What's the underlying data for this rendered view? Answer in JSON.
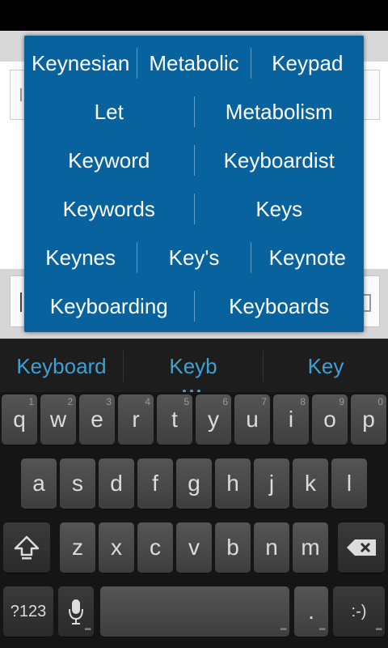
{
  "popup": {
    "rows": [
      [
        "Keynesian",
        "Metabolic",
        "Keypad"
      ],
      [
        "Let",
        "Metabolism"
      ],
      [
        "Keyword",
        "Keyboardist"
      ],
      [
        "Keywords",
        "Keys"
      ],
      [
        "Keynes",
        "Key's",
        "Keynote"
      ],
      [
        "Keyboarding",
        "Keyboards"
      ]
    ]
  },
  "suggestions": {
    "left": "Keyboard",
    "center": "Keyb",
    "right": "Key"
  },
  "keyboard": {
    "row1": [
      {
        "label": "q",
        "hint": "1"
      },
      {
        "label": "w",
        "hint": "2"
      },
      {
        "label": "e",
        "hint": "3"
      },
      {
        "label": "r",
        "hint": "4"
      },
      {
        "label": "t",
        "hint": "5"
      },
      {
        "label": "y",
        "hint": "6"
      },
      {
        "label": "u",
        "hint": "7"
      },
      {
        "label": "i",
        "hint": "8"
      },
      {
        "label": "o",
        "hint": "9"
      },
      {
        "label": "p",
        "hint": "0"
      }
    ],
    "row2": [
      "a",
      "s",
      "d",
      "f",
      "g",
      "h",
      "j",
      "k",
      "l"
    ],
    "row3": [
      "z",
      "x",
      "c",
      "v",
      "b",
      "n",
      "m"
    ],
    "symbols_label": "?123",
    "period_label": ".",
    "smiley_label": ":-)"
  },
  "colors": {
    "popup_bg": "#07629e",
    "suggestion_text": "#3fa0d4"
  }
}
